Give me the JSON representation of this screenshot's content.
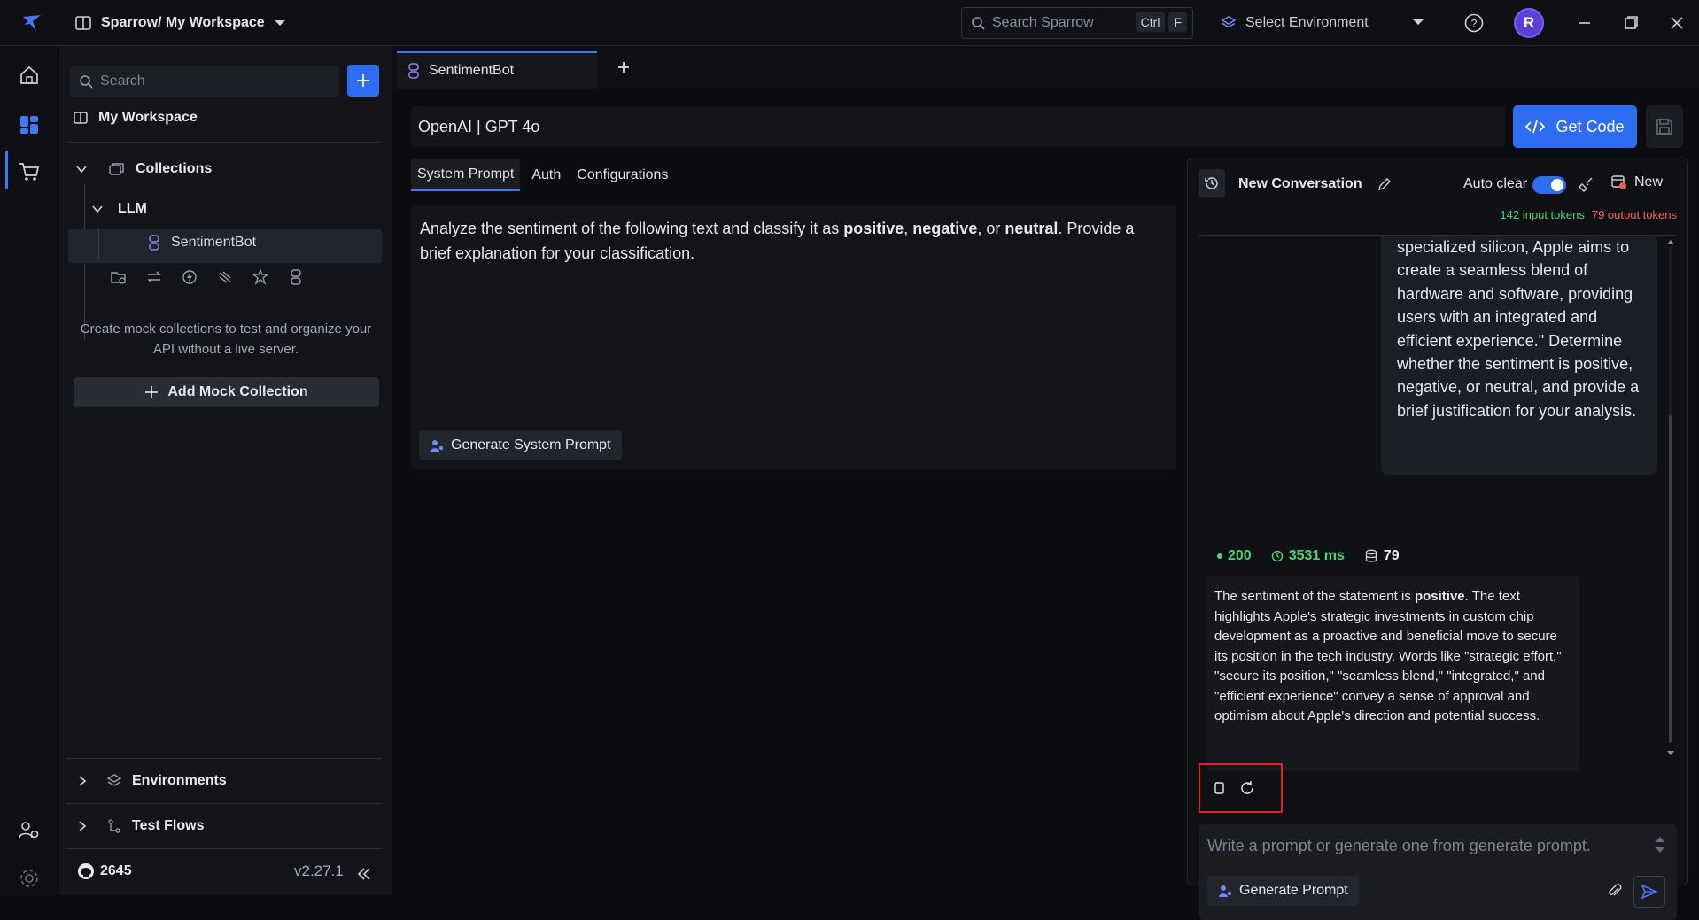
{
  "titlebar": {
    "workspace": "Sparrow/ My Workspace",
    "search_placeholder": "Search Sparrow",
    "kbd_ctrl": "Ctrl",
    "kbd_f": "F",
    "environment": "Select Environment",
    "avatar_letter": "R"
  },
  "sidebar": {
    "search_placeholder": "Search",
    "workspace_label": "My Workspace",
    "collections_label": "Collections",
    "llm_label": "LLM",
    "item_label": "SentimentBot",
    "mock_hint": "Create mock collections to test and organize your API without a live server.",
    "add_mock_label": "Add Mock Collection",
    "environments_label": "Environments",
    "testflows_label": "Test Flows",
    "github_stars": "2645",
    "version": "v2.27.1"
  },
  "tab": {
    "label": "SentimentBot"
  },
  "model": {
    "name": "OpenAI | GPT 4o"
  },
  "get_code_label": "Get Code",
  "subtabs": [
    "System Prompt",
    "Auth",
    "Configurations"
  ],
  "system_prompt": {
    "before_positive": "Analyze the sentiment of the following text and classify it as ",
    "positive": "positive",
    "comma1": ", ",
    "negative": "negative",
    "or": ", or ",
    "neutral": "neutral",
    "after": ". Provide a brief explanation for your classification.",
    "generate_label": "Generate System Prompt"
  },
  "chat": {
    "title": "New Conversation",
    "auto_clear_label": "Auto clear",
    "auto_clear_on": true,
    "new_label": "New",
    "input_tokens": "142 input tokens",
    "output_tokens": "79 output tokens",
    "user_message": "specialized silicon, Apple aims to create a seamless blend of hardware and software, providing users with an integrated and efficient experience.\" Determine whether the sentiment is positive, negative, or neutral, and provide a brief justification for your analysis.",
    "status": "200",
    "time": "3531 ms",
    "tokens": "79",
    "reply_before": "The sentiment of the statement is ",
    "reply_bold": "positive",
    "reply_after": ". The text highlights Apple's strategic investments in custom chip development as a proactive and beneficial move to secure its position in the tech industry. Words like \"strategic effort,\" \"secure its position,\" \"seamless blend,\" \"integrated,\" and \"efficient experience\" convey a sense of approval and optimism about Apple's direction and potential success.",
    "input_placeholder": "Write a prompt or generate one from generate prompt.",
    "generate_prompt_label": "Generate Prompt"
  },
  "colors": {
    "accent": "#2f6df0",
    "success": "#4bd47c",
    "danger": "#f0656b",
    "highlight_box": "#e0202a"
  }
}
